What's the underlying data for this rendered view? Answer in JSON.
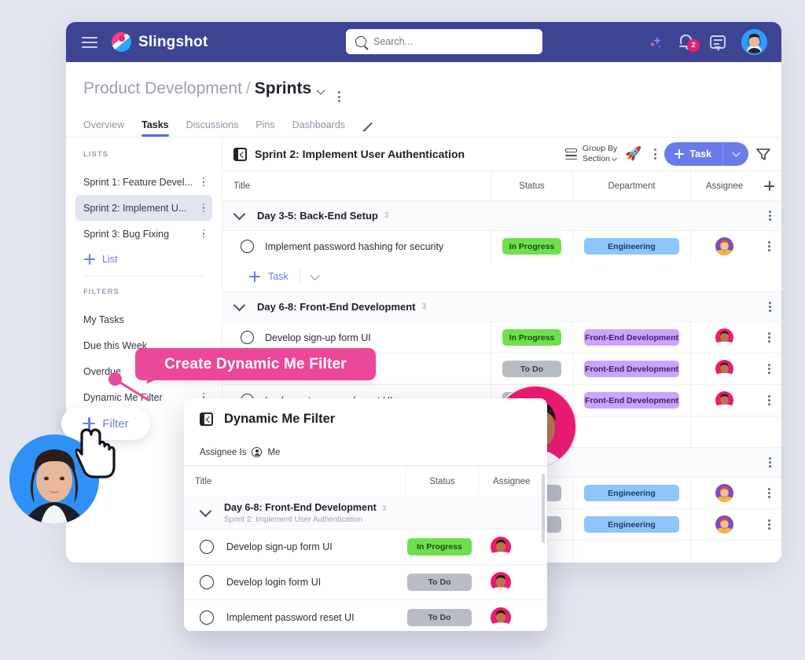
{
  "topbar": {
    "brand": "Slingshot",
    "search_placeholder": "Search...",
    "notification_count": "2"
  },
  "header": {
    "breadcrumb_parent": "Product Development",
    "breadcrumb_separator": "/",
    "breadcrumb_current": "Sprints",
    "tabs": [
      {
        "label": "Overview",
        "active": false
      },
      {
        "label": "Tasks",
        "active": true
      },
      {
        "label": "Discussions",
        "active": false
      },
      {
        "label": "Pins",
        "active": false
      },
      {
        "label": "Dashboards",
        "active": false
      }
    ]
  },
  "sidebar": {
    "lists_header": "LISTS",
    "lists": [
      {
        "label": "Sprint 1: Feature Devel...",
        "selected": false
      },
      {
        "label": "Sprint 2: Implement U...",
        "selected": true
      },
      {
        "label": "Sprint 3: Bug Fixing",
        "selected": false
      }
    ],
    "add_list_label": "List",
    "filters_header": "FILTERS",
    "filters": [
      {
        "label": "My Tasks"
      },
      {
        "label": "Due this Week"
      },
      {
        "label": "Overdue"
      },
      {
        "label": "Dynamic Me Filter"
      }
    ]
  },
  "list_panel": {
    "title": "Sprint 2: Implement User Authentication",
    "group_by_label": "Group By",
    "group_by_value": "Section",
    "add_task_label": "Task",
    "columns": [
      "Title",
      "Status",
      "Department",
      "Assignee"
    ],
    "groups": [
      {
        "name": "Day 3-5: Back-End Setup",
        "count": "3",
        "tasks": [
          {
            "title": "Implement password hashing for security",
            "status": "In Progress",
            "status_kind": "inprogress",
            "department": "Engineering",
            "dept_kind": "eng",
            "assignee": "male-beard-avatar"
          }
        ],
        "add_task_label": "Task"
      },
      {
        "name": "Day 6-8: Front-End Development",
        "count": "3",
        "tasks": [
          {
            "title": "Develop sign-up form UI",
            "status": "In Progress",
            "status_kind": "inprogress",
            "department": "Front-End Development",
            "dept_kind": "fe",
            "assignee": "male-pink-avatar"
          },
          {
            "title": "Develop login form UI",
            "status": "To Do",
            "status_kind": "todo",
            "department": "Front-End Development",
            "dept_kind": "fe",
            "assignee": "male-pink-avatar"
          },
          {
            "title": "Implement password reset UI",
            "status": "To Do",
            "status_kind": "todo",
            "department": "Front-End Development",
            "dept_kind": "fe",
            "assignee": "male-pink-avatar"
          }
        ]
      },
      {
        "name": "",
        "count": "",
        "tasks": [
          {
            "title": "",
            "status": "To Do",
            "status_kind": "todo",
            "department": "Engineering",
            "dept_kind": "eng",
            "assignee": "male-beard-avatar"
          },
          {
            "title": "",
            "status": "To Do",
            "status_kind": "todo",
            "department": "Engineering",
            "dept_kind": "eng",
            "assignee": "male-beard-avatar"
          }
        ]
      }
    ]
  },
  "callout": {
    "text": "Create Dynamic Me Filter"
  },
  "filter_button": {
    "label": "Filter"
  },
  "popup": {
    "title": "Dynamic Me Filter",
    "condition_label": "Assignee Is",
    "condition_value": "Me",
    "columns": [
      "Title",
      "Status",
      "Assignee"
    ],
    "group": {
      "name": "Day 6-8: Front-End Development",
      "count": "3",
      "subtitle": "Sprint 2: Implement User Authentication"
    },
    "tasks": [
      {
        "title": "Develop sign-up form UI",
        "status": "In Progress",
        "status_kind": "inprogress"
      },
      {
        "title": "Develop login form UI",
        "status": "To Do",
        "status_kind": "todo"
      },
      {
        "title": "Implement password reset UI",
        "status": "To Do",
        "status_kind": "todo"
      }
    ]
  },
  "colors": {
    "navbar": "#3d4493",
    "accent": "#6b7bec",
    "callout_pink": "#ec4899",
    "status_inprogress": "#6ee04e",
    "status_todo": "#b8bcc4",
    "dept_engineering": "#8ec5fc",
    "dept_frontend": "#c9a6fb",
    "page_background": "#e4e6ef"
  }
}
